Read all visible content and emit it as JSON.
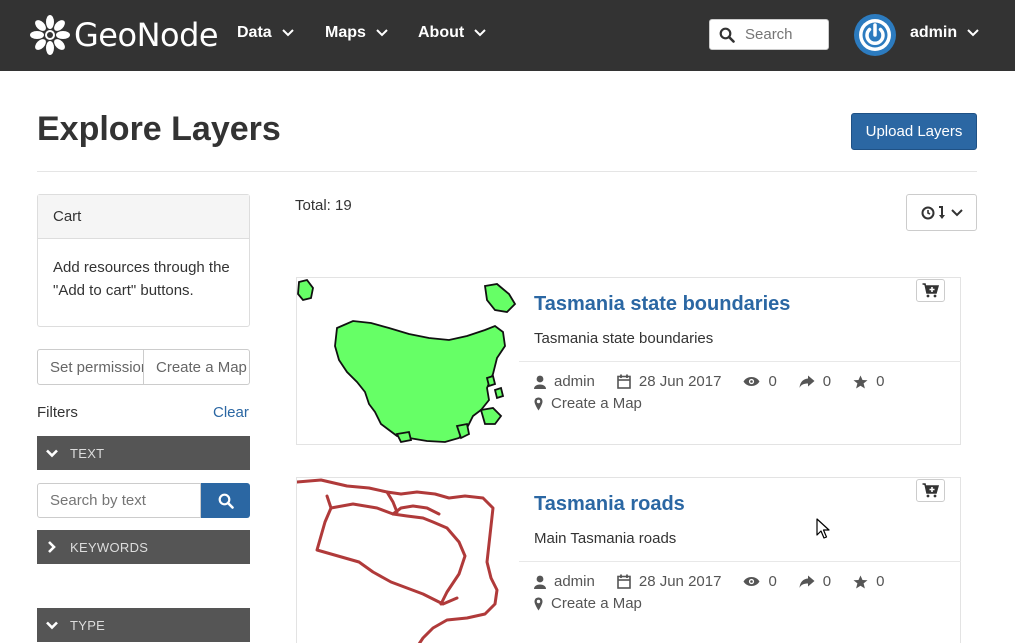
{
  "navbar": {
    "brand": "GeoNode",
    "menu": [
      {
        "label": "Data"
      },
      {
        "label": "Maps"
      },
      {
        "label": "About"
      }
    ],
    "search_placeholder": "Search",
    "user": "admin"
  },
  "header": {
    "title": "Explore Layers",
    "upload_label": "Upload Layers"
  },
  "sidebar": {
    "cart_title": "Cart",
    "cart_text": "Add resources through the \"Add to cart\" buttons.",
    "set_permissions": "Set permissions",
    "create_map": "Create a Map",
    "filters_label": "Filters",
    "clear_label": "Clear",
    "filter_text": "TEXT",
    "text_search_placeholder": "Search by text",
    "filter_keywords": "KEYWORDS",
    "filter_type": "TYPE"
  },
  "main": {
    "total": "Total: 19",
    "layers": [
      {
        "title": "Tasmania state boundaries",
        "abstract": "Tasmania state boundaries",
        "owner": "admin",
        "date": "28 Jun 2017",
        "views": "0",
        "shares": "0",
        "rating": "0",
        "create_map": "Create a Map"
      },
      {
        "title": "Tasmania roads",
        "abstract": "Main Tasmania roads",
        "owner": "admin",
        "date": "28 Jun 2017",
        "views": "0",
        "shares": "0",
        "rating": "0",
        "create_map": "Create a Map"
      }
    ]
  },
  "colors": {
    "navbar_bg": "#333333",
    "primary": "#2b67a3",
    "filter_bar": "#555555",
    "tasmania_fill": "#66ff66",
    "roads_stroke": "#b03a3a"
  }
}
